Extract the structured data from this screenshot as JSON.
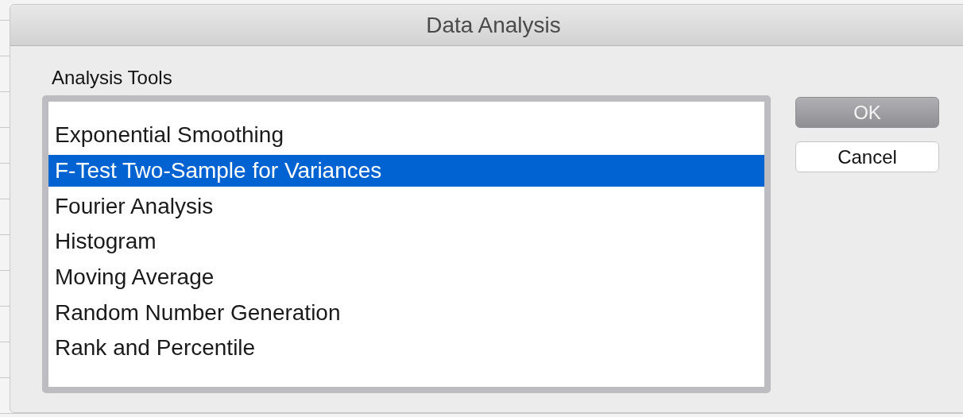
{
  "window": {
    "title": "Data Analysis"
  },
  "analysis_tools": {
    "label": "Analysis Tools",
    "items": [
      {
        "label": "Exponential Smoothing",
        "selected": false
      },
      {
        "label": "F-Test Two-Sample for Variances",
        "selected": true
      },
      {
        "label": "Fourier Analysis",
        "selected": false
      },
      {
        "label": "Histogram",
        "selected": false
      },
      {
        "label": "Moving Average",
        "selected": false
      },
      {
        "label": "Random Number Generation",
        "selected": false
      },
      {
        "label": "Rank and Percentile",
        "selected": false
      }
    ]
  },
  "buttons": [
    {
      "label": "OK",
      "default": true
    },
    {
      "label": "Cancel",
      "default": false
    }
  ]
}
